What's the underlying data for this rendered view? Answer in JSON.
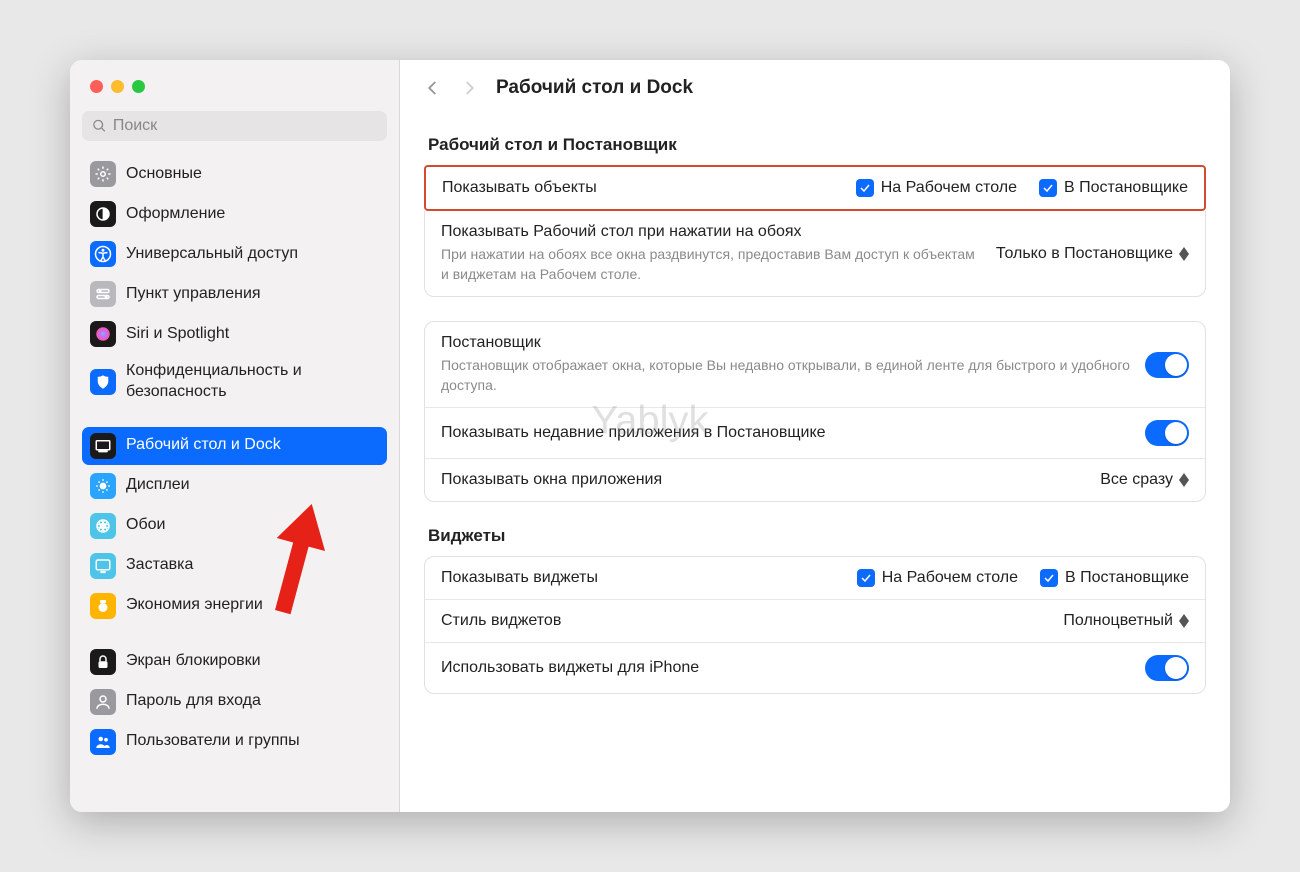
{
  "search": {
    "placeholder": "Поиск"
  },
  "sidebar": {
    "groups": [
      [
        {
          "label": "Основные",
          "icon": "gear-icon",
          "bg": "#9a9a9e",
          "fg": "#fff"
        },
        {
          "label": "Оформление",
          "icon": "appearance-icon",
          "bg": "#1a1a1a",
          "fg": "#fff"
        },
        {
          "label": "Универсальный доступ",
          "icon": "accessibility-icon",
          "bg": "#0b6bff",
          "fg": "#fff"
        },
        {
          "label": "Пункт управления",
          "icon": "control-center-icon",
          "bg": "#b8b8bd",
          "fg": "#fff"
        },
        {
          "label": "Siri и Spotlight",
          "icon": "siri-icon",
          "bg": "#1a1a1a",
          "fg": "#fff"
        },
        {
          "label": "Конфиденциальность и безопасность",
          "icon": "privacy-icon",
          "bg": "#0b6bff",
          "fg": "#fff"
        }
      ],
      [
        {
          "label": "Рабочий стол и Dock",
          "icon": "desktop-dock-icon",
          "bg": "#1a1a1a",
          "fg": "#fff",
          "selected": true
        },
        {
          "label": "Дисплеи",
          "icon": "displays-icon",
          "bg": "#2aa4ff",
          "fg": "#fff"
        },
        {
          "label": "Обои",
          "icon": "wallpaper-icon",
          "bg": "#4ec5e8",
          "fg": "#fff"
        },
        {
          "label": "Заставка",
          "icon": "screensaver-icon",
          "bg": "#4ec5e8",
          "fg": "#fff"
        },
        {
          "label": "Экономия энергии",
          "icon": "energy-icon",
          "bg": "#ffb400",
          "fg": "#fff"
        }
      ],
      [
        {
          "label": "Экран блокировки",
          "icon": "lockscreen-icon",
          "bg": "#1a1a1a",
          "fg": "#fff"
        },
        {
          "label": "Пароль для входа",
          "icon": "password-icon",
          "bg": "#9a9a9e",
          "fg": "#fff"
        },
        {
          "label": "Пользователи и группы",
          "icon": "users-groups-icon",
          "bg": "#0b6bff",
          "fg": "#fff"
        }
      ]
    ]
  },
  "header": {
    "title": "Рабочий стол и Dock"
  },
  "section1": {
    "title": "Рабочий стол и Постановщик",
    "row_show_objects": {
      "label": "Показывать объекты",
      "cb1": "На Рабочем столе",
      "cb2": "В Постановщике"
    },
    "row_show_desktop": {
      "label": "Показывать Рабочий стол при нажатии на обоях",
      "desc": "При нажатии на обоях все окна раздвинутся, предоставив Вам доступ к объектам и виджетам на Рабочем столе.",
      "value": "Только в Постановщике"
    }
  },
  "section2": {
    "row_stage": {
      "label": "Постановщик",
      "desc": "Постановщик отображает окна, которые Вы недавно открывали, в единой ленте для быстрого и удобного доступа."
    },
    "row_recent": {
      "label": "Показывать недавние приложения в Постановщике"
    },
    "row_windows": {
      "label": "Показывать окна приложения",
      "value": "Все сразу"
    }
  },
  "section3": {
    "title": "Виджеты",
    "row_show_widgets": {
      "label": "Показывать виджеты",
      "cb1": "На Рабочем столе",
      "cb2": "В Постановщике"
    },
    "row_style": {
      "label": "Стиль виджетов",
      "value": "Полноцветный"
    },
    "row_iphone": {
      "label": "Использовать виджеты для iPhone"
    }
  },
  "watermark": "Yablyk"
}
